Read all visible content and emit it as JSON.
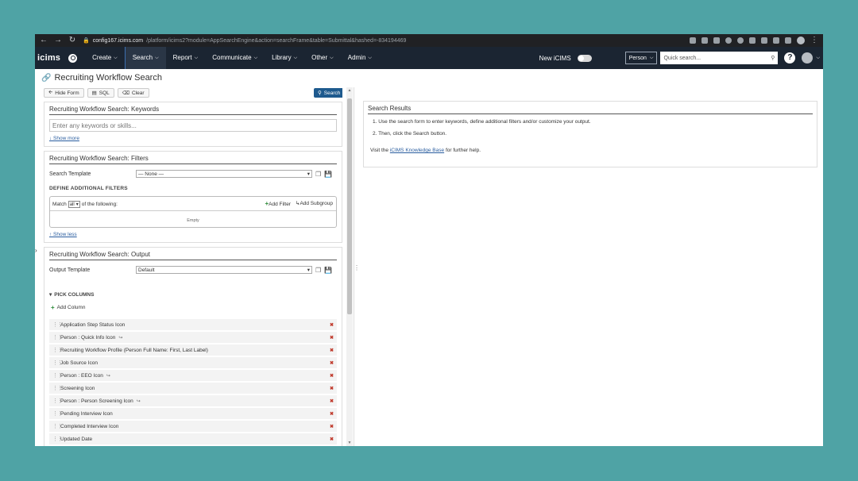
{
  "browser": {
    "url_host": "config167.icims.com",
    "url_rest": "/platform/icims2?module=AppSearchEngine&action=searchFrame&table=Submittal&hashed=-834194469"
  },
  "nav": {
    "logo": "icims",
    "items": [
      {
        "label": "Create"
      },
      {
        "label": "Search"
      },
      {
        "label": "Report"
      },
      {
        "label": "Communicate"
      },
      {
        "label": "Library"
      },
      {
        "label": "Other"
      },
      {
        "label": "Admin"
      }
    ],
    "new_icims_label": "New iCIMS",
    "person_select": "Person",
    "quick_search_placeholder": "Quick search...",
    "help": "?"
  },
  "page": {
    "title": "Recruiting Workflow Search"
  },
  "toolbar": {
    "hide_form": "Hide Form",
    "sql": "SQL",
    "clear": "Clear",
    "search": "Search"
  },
  "keywords": {
    "title": "Recruiting Workflow Search: Keywords",
    "placeholder": "Enter any keywords or skills...",
    "show_more": "↓ Show more"
  },
  "filters": {
    "title": "Recruiting Workflow Search: Filters",
    "search_template_label": "Search Template",
    "search_template_value": "— None —",
    "define_label": "DEFINE ADDITIONAL FILTERS",
    "match_prefix": "Match",
    "match_value": "all",
    "match_suffix": "of the following:",
    "add_filter": "Add Filter",
    "add_subgroup": "Add Subgroup",
    "empty": "Empty",
    "show_less": "↑ Show less"
  },
  "output": {
    "title": "Recruiting Workflow Search: Output",
    "template_label": "Output Template",
    "template_value": "Default",
    "pick_columns": "PICK COLUMNS",
    "add_column": "Add Column",
    "columns": [
      {
        "label": "Application Step Status Icon",
        "has_icon": false
      },
      {
        "label": "Person : Quick Info Icon",
        "has_icon": true
      },
      {
        "label": "Recruiting Workflow Profile (Person Full Name: First, Last Label)",
        "has_icon": false
      },
      {
        "label": "Job Source Icon",
        "has_icon": false
      },
      {
        "label": "Person : EEO Icon",
        "has_icon": true
      },
      {
        "label": "Screening Icon",
        "has_icon": false
      },
      {
        "label": "Person : Person Screening Icon",
        "has_icon": true
      },
      {
        "label": "Pending Interview Icon",
        "has_icon": false
      },
      {
        "label": "Completed Interview Icon",
        "has_icon": false
      },
      {
        "label": "Updated Date",
        "has_icon": false
      }
    ]
  },
  "results": {
    "title": "Search Results",
    "step1": "1. Use the search form to enter keywords, define additional filters and/or customize your output.",
    "step2": "2. Then, click the Search button.",
    "help_prefix": "Visit the",
    "help_link": "iCIMS Knowledge Base",
    "help_suffix": "for further help."
  },
  "colors": {
    "background": "#4fa3a5",
    "nav_bg": "#1b2532",
    "search_button": "#1e5a8e",
    "link": "#2a5d9f",
    "remove": "#c0392b",
    "add": "#2e8b3a"
  }
}
